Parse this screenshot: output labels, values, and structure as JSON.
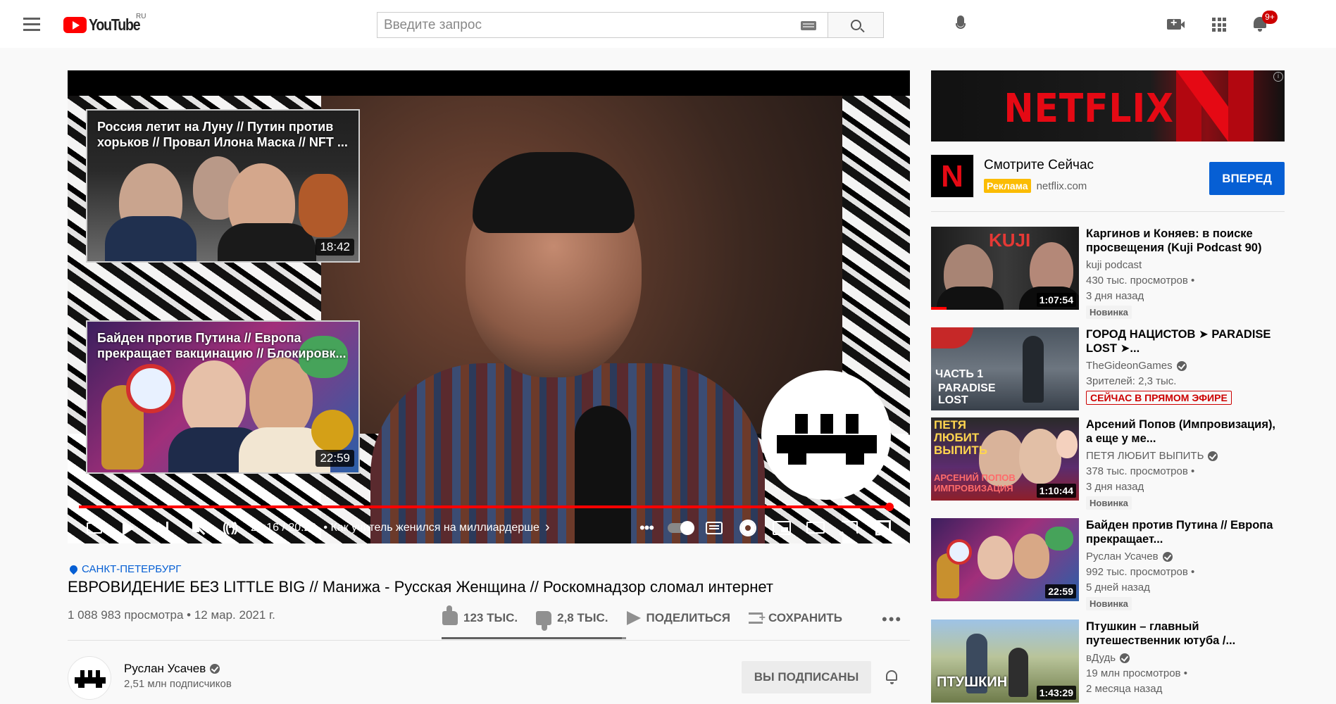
{
  "header": {
    "logo_text": "YouTube",
    "region": "RU",
    "search_placeholder": "Введите запрос",
    "notification_count": "9+"
  },
  "player": {
    "endcards": [
      {
        "title": "Россия летит на Луну // Путин против хорьков // Провал Илона Маска // NFT ...",
        "duration": "18:42"
      },
      {
        "title": "Байден против Путина // Европа прекращает вакцинацию // Блокировк...",
        "duration": "22:59"
      }
    ],
    "time": "20:16 / 20:29",
    "chapter": "• Как учитель женился на миллиардерше",
    "chapter_chevron": "›",
    "progress": 0.989
  },
  "video": {
    "location": "САНКТ-ПЕТЕРБУРГ",
    "title": "ЕВРОВИДЕНИЕ БЕЗ LITTLE BIG // Манижа - Русская Женщина // Роскомнадзор сломал интернет",
    "views_date": "1 088 983 просмотра • 12 мар. 2021 г.",
    "likes": "123 ТЫС.",
    "dislikes": "2,8 ТЫС.",
    "share_label": "ПОДЕЛИТЬСЯ",
    "save_label": "СОХРАНИТЬ",
    "like_ratio": 0.978
  },
  "channel": {
    "name": "Руслан Усачев",
    "subscribers": "2,51 млн подписчиков",
    "subscribed_label": "ВЫ ПОДПИСАНЫ"
  },
  "ad": {
    "banner_text": "NETFLIX",
    "title": "Смотрите Сейчас",
    "tag": "Реклама",
    "domain": "netflix.com",
    "cta": "ВПЕРЕД"
  },
  "recommendations": [
    {
      "title": "Каргинов и Коняев: в поиске просвещения (Kuji Podcast 90)",
      "channel": "kuji podcast",
      "verified": false,
      "views": "430 тыс. просмотров •",
      "age": "3 дня назад",
      "badge": "Новинка",
      "duration": "1:07:54",
      "thumb_text": "KUJI",
      "watched": true
    },
    {
      "title": "ГОРОД НАЦИСТОВ ➤ PARADISE LOST ➤...",
      "channel": "TheGideonGames",
      "verified": true,
      "views": "Зрителей: 2,3 тыс.",
      "live": "СЕЙЧАС В ПРЯМОМ ЭФИРЕ",
      "thumb_text": "ЧАСТЬ 1",
      "thumb_sub": "PARADISE LOST"
    },
    {
      "title": "Арсений Попов (Импровизация), а еще у ме...",
      "channel": "ПЕТЯ ЛЮБИТ ВЫПИТЬ",
      "verified": true,
      "views": "378 тыс. просмотров •",
      "age": "3 дня назад",
      "badge": "Новинка",
      "duration": "1:10:44",
      "thumb_text": "ПЕТЯ ЛЮБИТ ВЫПИТЬ",
      "thumb_sub": "АРСЕНИЙ ПОПОВ ИМПРОВИЗАЦИЯ"
    },
    {
      "title": "Байден против Путина // Европа прекращает...",
      "channel": "Руслан Усачев",
      "verified": true,
      "views": "992 тыс. просмотров •",
      "age": "5 дней назад",
      "badge": "Новинка",
      "duration": "22:59"
    },
    {
      "title": "Птушкин – главный путешественник ютуба /...",
      "channel": "вДудь",
      "verified": true,
      "views": "19 млн просмотров •",
      "age": "2 месяца назад",
      "duration": "1:43:29",
      "thumb_text": "ПТУШКИН"
    }
  ],
  "colors": {
    "brand_red": "#ff0000",
    "link_blue": "#065fd4",
    "netflix_red": "#e50914"
  }
}
